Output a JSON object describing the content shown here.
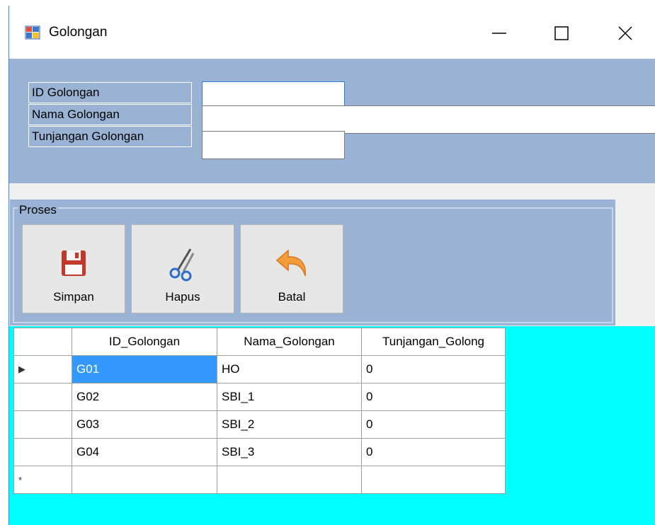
{
  "window": {
    "title": "Golongan",
    "minimize_icon": "minimize-icon",
    "maximize_icon": "maximize-icon",
    "close_icon": "close-icon"
  },
  "form": {
    "fields": [
      {
        "label": "ID Golongan",
        "value": ""
      },
      {
        "label": "Nama Golongan",
        "value": ""
      },
      {
        "label": "Tunjangan Golongan",
        "value": ""
      }
    ]
  },
  "proses": {
    "group_label": "Proses",
    "buttons": [
      {
        "label": "Simpan",
        "icon": "floppy-save-icon"
      },
      {
        "label": "Hapus",
        "icon": "scissors-icon"
      },
      {
        "label": "Batal",
        "icon": "undo-arrow-icon"
      }
    ]
  },
  "grid": {
    "columns": [
      "ID_Golongan",
      "Nama_Golongan",
      "Tunjangan_Golong"
    ],
    "rows": [
      [
        "G01",
        "HO",
        "0"
      ],
      [
        "G02",
        "SBI_1",
        "0"
      ],
      [
        "G03",
        "SBI_2",
        "0"
      ],
      [
        "G04",
        "SBI_3",
        "0"
      ]
    ],
    "current_row_marker": "▶",
    "new_row_marker": "*",
    "selection_color": "#3399ff",
    "background_color": "#00ffff"
  }
}
